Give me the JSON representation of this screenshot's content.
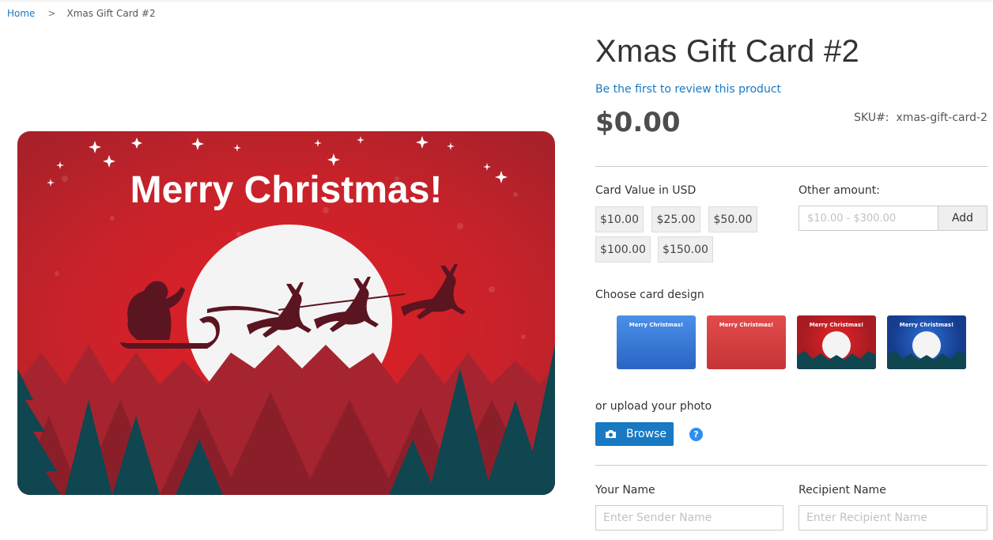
{
  "breadcrumb": {
    "home": "Home",
    "separator": ">",
    "current": "Xmas Gift Card #2"
  },
  "product": {
    "title": "Xmas Gift Card #2",
    "review_link": "Be the first to review this product",
    "price": "$0.00",
    "sku_label": "SKU#:",
    "sku_value": "xmas-gift-card-2"
  },
  "hero_image": {
    "text": "Merry Christmas!",
    "alt": "Red Christmas card with Santa sleigh and reindeer over moon"
  },
  "card_value": {
    "label": "Card Value in USD",
    "amounts": [
      "$10.00",
      "$25.00",
      "$50.00",
      "$100.00",
      "$150.00"
    ]
  },
  "other_amount": {
    "label": "Other amount:",
    "placeholder": "$10.00 - $300.00",
    "add_label": "Add"
  },
  "card_design": {
    "label": "Choose card design",
    "designs": [
      {
        "name": "blue-pattern",
        "text": "Merry Christmas!"
      },
      {
        "name": "red-pattern",
        "text": "Merry Christmas!"
      },
      {
        "name": "red-santa",
        "text": "Merry Christmas!"
      },
      {
        "name": "blue-santa",
        "text": "Merry Christmas!"
      }
    ]
  },
  "upload": {
    "label": "or upload your photo",
    "browse_label": "Browse",
    "help": "?"
  },
  "names": {
    "your_name_label": "Your Name",
    "your_name_placeholder": "Enter Sender Name",
    "recipient_label": "Recipient Name",
    "recipient_placeholder": "Enter Recipient Name"
  },
  "colors": {
    "link": "#1979c3",
    "primary_button": "#1979c3",
    "help_icon": "#2e8ff0",
    "card_red": "#c8222a",
    "tree_teal": "#0f4650"
  }
}
